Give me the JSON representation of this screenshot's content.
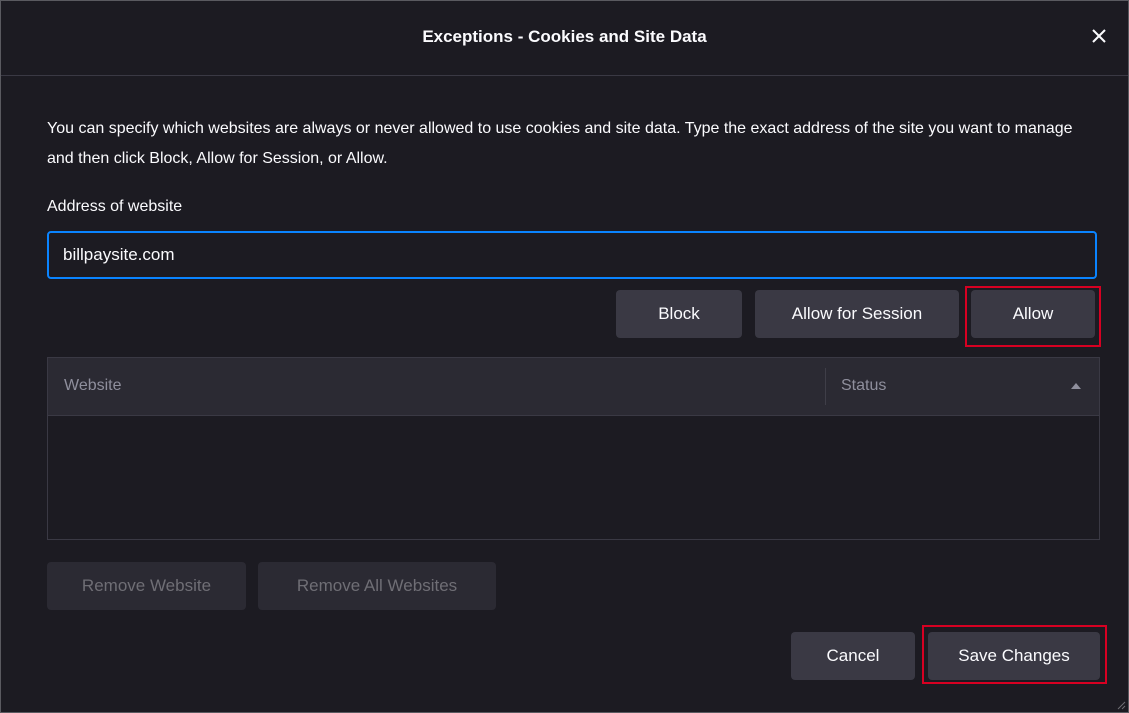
{
  "dialog": {
    "title": "Exceptions - Cookies and Site Data",
    "close_icon": "close-icon"
  },
  "description": "You can specify which websites are always or never allowed to use cookies and site data. Type the exact address of the site you want to manage and then click Block, Allow for Session, or Allow.",
  "address": {
    "label": "Address of website",
    "value": "billpaysite.com",
    "placeholder": ""
  },
  "actions": {
    "block": "Block",
    "allow_session": "Allow for Session",
    "allow": "Allow"
  },
  "table": {
    "columns": [
      "Website",
      "Status"
    ],
    "sort_icon": "sort-ascending-icon",
    "rows": []
  },
  "list_actions": {
    "remove_website": "Remove Website",
    "remove_all": "Remove All Websites"
  },
  "footer": {
    "cancel": "Cancel",
    "save": "Save Changes"
  },
  "colors": {
    "accent": "#0a84ff",
    "highlight": "#d70022",
    "background": "#1c1b22",
    "button": "#3a3944"
  }
}
